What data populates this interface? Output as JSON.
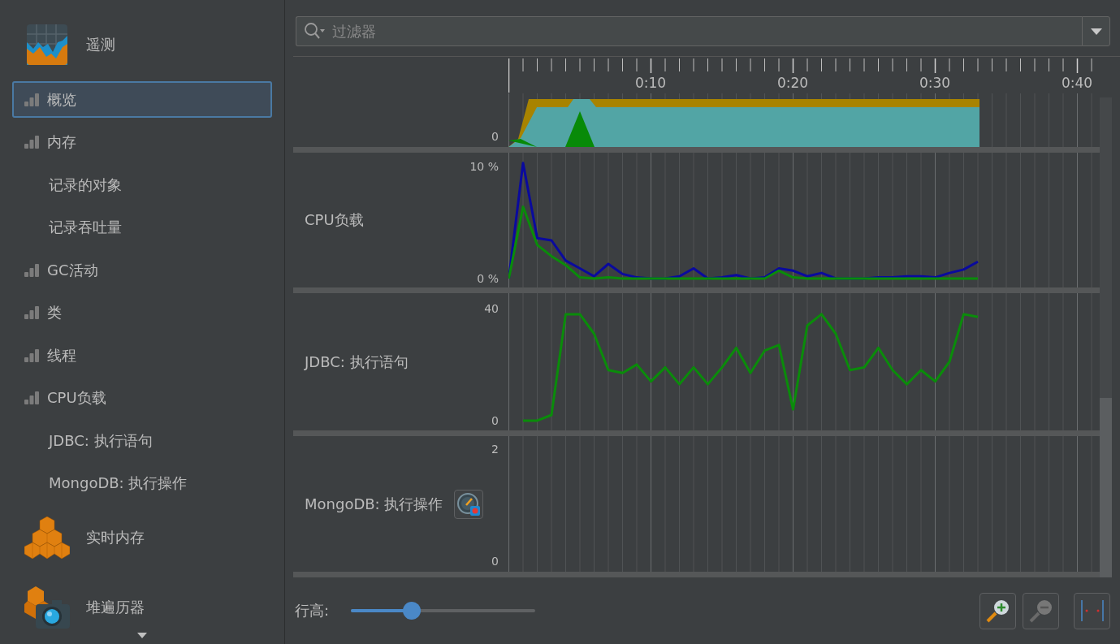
{
  "sidebar": {
    "sections": [
      {
        "label": "遥测",
        "items": [
          {
            "label": "概览",
            "kind": "graph",
            "selected": true
          },
          {
            "label": "内存",
            "kind": "graph",
            "selected": false
          },
          {
            "label": "记录的对象",
            "kind": "plain",
            "selected": false
          },
          {
            "label": "记录吞吐量",
            "kind": "plain",
            "selected": false
          },
          {
            "label": "GC活动",
            "kind": "graph",
            "selected": false
          },
          {
            "label": "类",
            "kind": "graph",
            "selected": false
          },
          {
            "label": "线程",
            "kind": "graph",
            "selected": false
          },
          {
            "label": "CPU负载",
            "kind": "graph",
            "selected": false
          },
          {
            "label": "JDBC: 执行语句",
            "kind": "plain",
            "selected": false
          },
          {
            "label": "MongoDB: 执行操作",
            "kind": "plain",
            "selected": false
          }
        ]
      },
      {
        "label": "实时内存"
      },
      {
        "label": "堆遍历器"
      }
    ]
  },
  "filter": {
    "placeholder": "过滤器"
  },
  "time_axis": {
    "labels": [
      "0:10",
      "0:20",
      "0:30",
      "0:40"
    ]
  },
  "overview": {
    "tick": "0"
  },
  "rows": [
    {
      "label": "CPU负载",
      "kind": "plain",
      "chart_data": {
        "type": "line",
        "grid": true,
        "categories": [
          null,
          null,
          null,
          null,
          null,
          null,
          null,
          null,
          null,
          null,
          null,
          null,
          null,
          null,
          null,
          null,
          null,
          null,
          null,
          null,
          null,
          null,
          null,
          null,
          null,
          null,
          null,
          null,
          null,
          null,
          null,
          null,
          null,
          null
        ],
        "ylim": [
          -0.8,
          11.23
        ],
        "yticks": [
          {
            "value": 0,
            "label": "0 %"
          },
          {
            "value": 10,
            "label": "10 %"
          }
        ],
        "series": [
          {
            "color": "#0a0a9e",
            "values": [
              0,
              10.3,
              3.6,
              3.4,
              1.6,
              0.9,
              0.2,
              1.3,
              0.4,
              0.1,
              0,
              0,
              0.2,
              0.9,
              0,
              0.1,
              0.3,
              0,
              0.1,
              0.9,
              0.7,
              0.2,
              0.5,
              0,
              0,
              0,
              0.1,
              0.1,
              0.2,
              0.2,
              0.1,
              0.5,
              0.8,
              1.5
            ]
          },
          {
            "color": "#0a8c0a",
            "values": [
              0,
              6.4,
              3,
              2,
              1.2,
              0.1,
              0,
              0.1,
              0,
              0,
              0,
              0,
              0,
              0,
              0,
              0,
              0,
              0,
              0,
              0.7,
              0.1,
              0,
              0,
              0,
              0,
              0,
              0,
              0,
              0,
              0,
              0,
              0,
              0,
              0
            ]
          }
        ]
      }
    },
    {
      "label": "JDBC: 执行语句",
      "kind": "plain",
      "chart_data": {
        "type": "line",
        "grid": true,
        "categories": [
          null,
          null,
          null,
          null,
          null,
          null,
          null,
          null,
          null,
          null,
          null,
          null,
          null,
          null,
          null,
          null,
          null,
          null,
          null,
          null,
          null,
          null,
          null,
          null,
          null,
          null,
          null,
          null,
          null,
          null,
          null,
          null,
          null,
          null
        ],
        "ylim": [
          -3.5,
          45.5
        ],
        "yticks": [
          {
            "value": 0,
            "label": "0"
          },
          {
            "value": 40,
            "label": "40"
          }
        ],
        "series": [
          {
            "color": "#0a8c0a",
            "values": [
              null,
              0,
              0,
              2,
              38,
              38,
              31,
              18,
              17,
              20,
              14,
              19,
              13,
              19,
              13,
              19,
              26,
              17,
              25,
              27,
              4,
              34,
              38,
              31,
              18,
              19,
              26,
              18,
              13,
              18,
              14,
              21,
              38,
              37
            ]
          }
        ]
      }
    },
    {
      "label": "MongoDB: 执行操作",
      "kind": "recordable",
      "ticks": [
        "2",
        "0"
      ]
    }
  ],
  "row_height": {
    "label": "行高:",
    "level": 0.33
  },
  "buttons": [
    {
      "kind": "zoom-in",
      "disabled": false
    },
    {
      "kind": "zoom-out",
      "disabled": true
    },
    {
      "kind": "fit",
      "disabled": false
    }
  ]
}
